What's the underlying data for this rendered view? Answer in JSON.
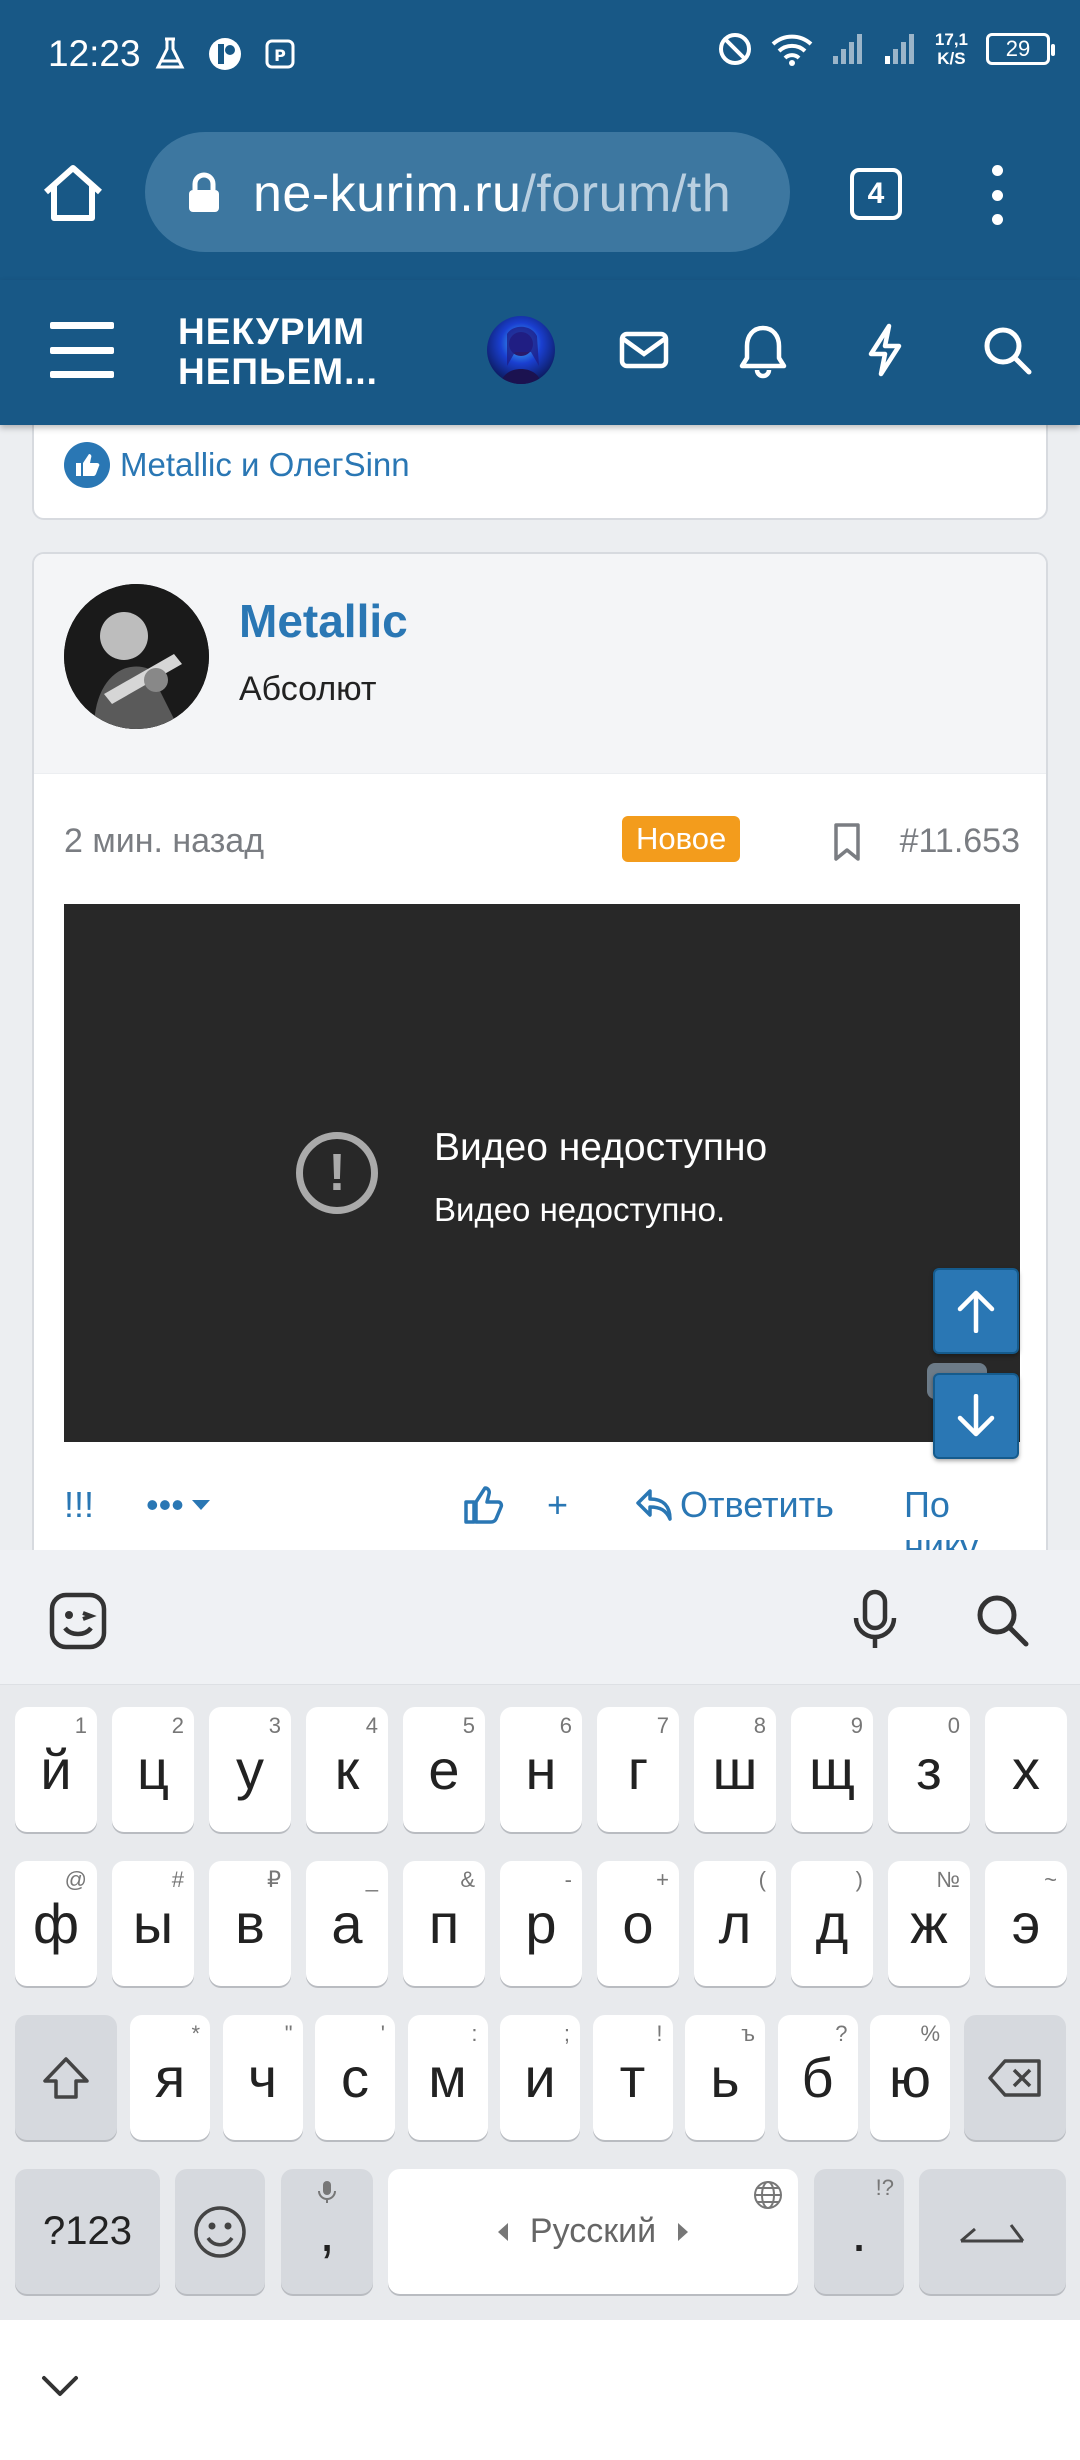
{
  "status_bar": {
    "time": "12:23",
    "net_speed_value": "17,1",
    "net_speed_unit": "K/S",
    "battery": "29"
  },
  "browser": {
    "url_host": "ne-kurim.ru",
    "url_path": "/forum/th",
    "tab_count": "4"
  },
  "site_header": {
    "logo_line1": "НЕКУРИМ",
    "logo_line2": "НЕПЬЕМ..."
  },
  "previous_post": {
    "reactions_text": "Metallic и ОлегSinn"
  },
  "post": {
    "author_name": "Metallic",
    "author_title": "Абсолют",
    "time": "2 мин. назад",
    "badge": "Новое",
    "number": "#11.653",
    "video_title": "Видео недоступно",
    "video_subtitle": "Видео недоступно.",
    "actions": {
      "exclaim": "!!!",
      "more": "•••",
      "plus": "+",
      "reply": "Ответить",
      "by_nick": "По нику"
    }
  },
  "keyboard": {
    "row1": [
      {
        "key": "й",
        "hint": "1"
      },
      {
        "key": "ц",
        "hint": "2"
      },
      {
        "key": "у",
        "hint": "3"
      },
      {
        "key": "к",
        "hint": "4"
      },
      {
        "key": "е",
        "hint": "5"
      },
      {
        "key": "н",
        "hint": "6"
      },
      {
        "key": "г",
        "hint": "7"
      },
      {
        "key": "ш",
        "hint": "8"
      },
      {
        "key": "щ",
        "hint": "9"
      },
      {
        "key": "з",
        "hint": "0"
      },
      {
        "key": "х",
        "hint": ""
      }
    ],
    "row2": [
      {
        "key": "ф",
        "hint": "@"
      },
      {
        "key": "ы",
        "hint": "#"
      },
      {
        "key": "в",
        "hint": "₽"
      },
      {
        "key": "а",
        "hint": "_"
      },
      {
        "key": "п",
        "hint": "&"
      },
      {
        "key": "р",
        "hint": "-"
      },
      {
        "key": "о",
        "hint": "+"
      },
      {
        "key": "л",
        "hint": "("
      },
      {
        "key": "д",
        "hint": ")"
      },
      {
        "key": "ж",
        "hint": "№"
      },
      {
        "key": "э",
        "hint": "~"
      }
    ],
    "row3": [
      {
        "key": "я",
        "hint": "*"
      },
      {
        "key": "ч",
        "hint": "\""
      },
      {
        "key": "с",
        "hint": "'"
      },
      {
        "key": "м",
        "hint": ":"
      },
      {
        "key": "и",
        "hint": ";"
      },
      {
        "key": "т",
        "hint": "!"
      },
      {
        "key": "ь",
        "hint": "ъ"
      },
      {
        "key": "б",
        "hint": "?"
      },
      {
        "key": "ю",
        "hint": "%"
      }
    ],
    "symbols_key": "?123",
    "comma_key": ",",
    "space_label": "Русский",
    "period_key": ".",
    "period_hint": "!?"
  },
  "colors": {
    "brand": "#185886",
    "link": "#2a77b4",
    "badge_new": "#f39c1c",
    "video_bg": "#282828"
  }
}
